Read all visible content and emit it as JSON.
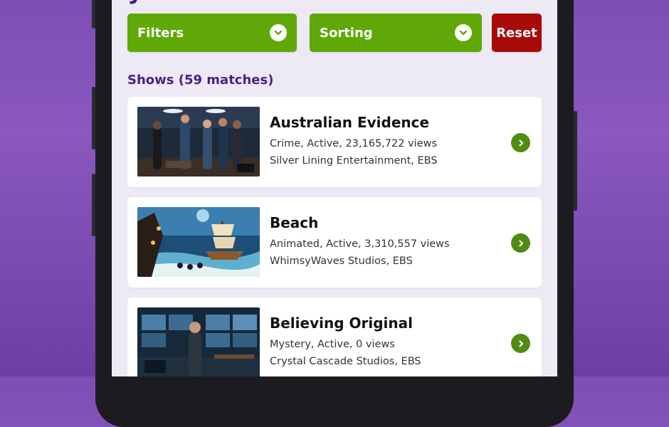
{
  "header": {
    "title_partial": "y"
  },
  "controls": {
    "filters_label": "Filters",
    "sorting_label": "Sorting",
    "reset_label": "Reset"
  },
  "list": {
    "heading": "Shows (59 matches)",
    "shows": [
      {
        "title": "Australian Evidence",
        "line1": "Crime, Active, 23,165,722 views",
        "line2": "Silver Lining Entertainment, EBS"
      },
      {
        "title": "Beach",
        "line1": "Animated, Active, 3,310,557 views",
        "line2": "WhimsyWaves Studios, EBS"
      },
      {
        "title": "Believing Original",
        "line1": "Mystery, Active, 0 views",
        "line2": "Crystal Cascade Studios, EBS"
      }
    ]
  },
  "icons": {
    "dropdown": "chevron-down-icon",
    "open": "chevron-right-icon"
  },
  "colors": {
    "accent_green": "#5fa808",
    "reset_red": "#a80a0a",
    "heading_purple": "#4a1f86",
    "go_button": "#4f8c12"
  }
}
